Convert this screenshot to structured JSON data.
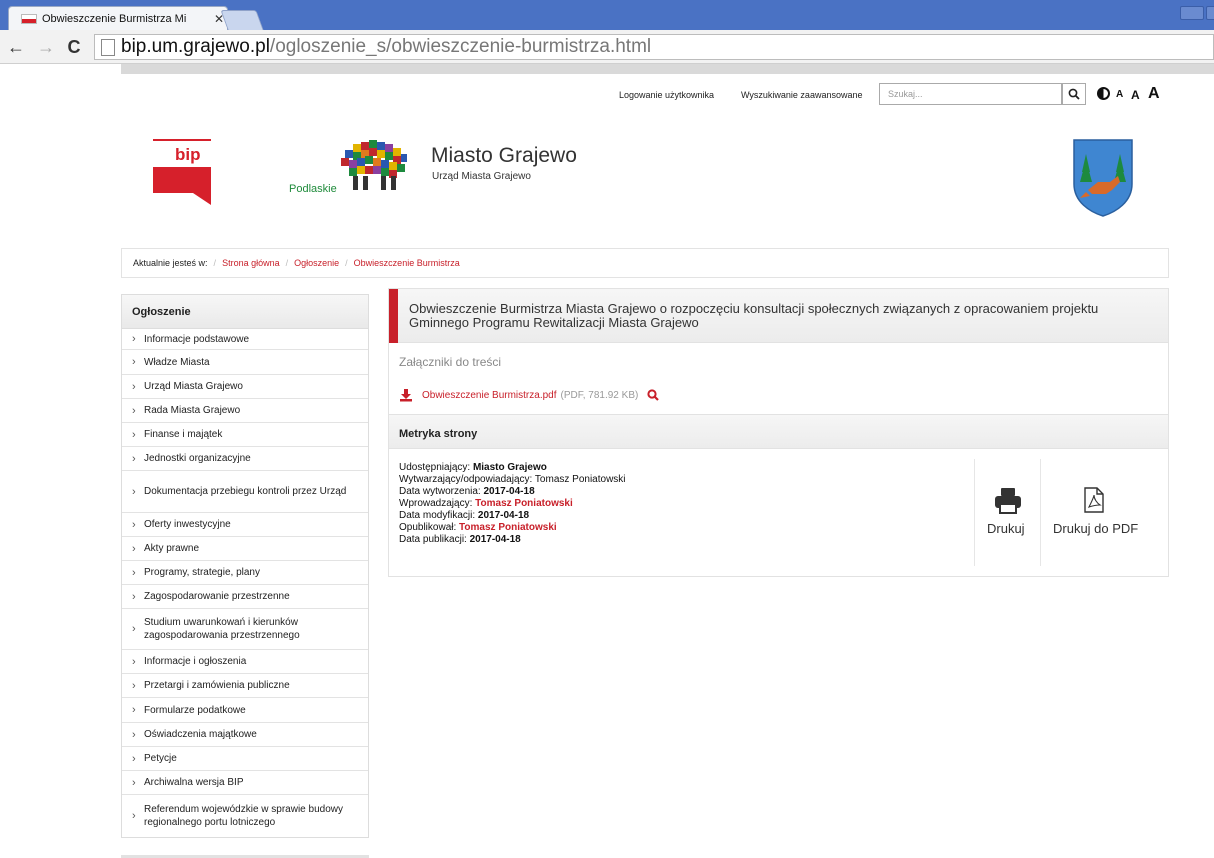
{
  "browser": {
    "tab_title": "Obwieszczenie Burmistrza Mi",
    "tab_close": "✕",
    "url_host": "bip.um.grajewo.pl",
    "url_path": "/ogloszenie_s/obwieszczenie-burmistrza.html"
  },
  "topbar": {
    "login": "Logowanie użytkownika",
    "advanced_search": "Wyszukiwanie zaawansowane",
    "search_placeholder": "Szukaj...",
    "font_sizes": [
      "A",
      "A",
      "A"
    ]
  },
  "header": {
    "bip_text": "bip",
    "podlaskie": "Podlaskie",
    "title": "Miasto Grajewo",
    "subtitle": "Urząd Miasta Grajewo"
  },
  "breadcrumb": {
    "prefix": "Aktualnie jesteś w:",
    "items": [
      "Strona główna",
      "Ogłoszenie",
      "Obwieszczenie Burmistrza"
    ]
  },
  "sidebar": {
    "heading": "Ogłoszenie",
    "items": [
      {
        "label": "Informacje podstawowe"
      },
      {
        "label": "Władze Miasta"
      },
      {
        "label": "Urząd Miasta Grajewo"
      },
      {
        "label": "Rada Miasta Grajewo"
      },
      {
        "label": "Finanse i majątek"
      },
      {
        "label": "Jednostki organizacyjne"
      },
      {
        "label": "Dokumentacja przebiegu kontroli przez Urząd"
      },
      {
        "label": "Oferty inwestycyjne"
      },
      {
        "label": "Akty prawne"
      },
      {
        "label": "Programy, strategie, plany"
      },
      {
        "label": "Zagospodarowanie przestrzenne"
      },
      {
        "label": "Studium uwarunkowań i kierunków zagospodarowania przestrzennego"
      },
      {
        "label": "Informacje i ogłoszenia"
      },
      {
        "label": "Przetargi i zamówienia publiczne"
      },
      {
        "label": "Formularze podatkowe"
      },
      {
        "label": "Oświadczenia majątkowe"
      },
      {
        "label": "Petycje"
      },
      {
        "label": "Archiwalna wersja BIP"
      },
      {
        "label": "Referendum wojewódzkie w sprawie budowy regionalnego portu lotniczego"
      }
    ]
  },
  "article": {
    "title": "Obwieszczenie Burmistrza Miasta Grajewo o rozpoczęciu konsultacji społecznych związanych z opracowaniem projektu Gminnego Programu Rewitalizacji Miasta Grajewo",
    "attachments_heading": "Załączniki do treści",
    "file_name": "Obwieszczenie Burmistrza.pdf",
    "file_meta": "(PDF, 781.92 KB)"
  },
  "metrics": {
    "heading": "Metryka strony",
    "shared_by_label": "Udostępniający:",
    "shared_by": "Miasto Grajewo",
    "producer_label": "Wytwarzający/odpowiadający:",
    "producer": "Tomasz Poniatowski",
    "created_label": "Data wytworzenia:",
    "created": "2017-04-18",
    "entered_label": "Wprowadzający:",
    "entered_by": "Tomasz Poniatowski",
    "modified_label": "Data modyfikacji:",
    "modified": "2017-04-18",
    "published_by_label": "Opublikował:",
    "published_by": "Tomasz Poniatowski",
    "published_label": "Data publikacji:",
    "published": "2017-04-18"
  },
  "actions": {
    "print": "Drukuj",
    "print_pdf": "Drukuj do PDF"
  },
  "colors": {
    "accent_red": "#c8202a",
    "chrome_blue": "#4a72c4"
  }
}
